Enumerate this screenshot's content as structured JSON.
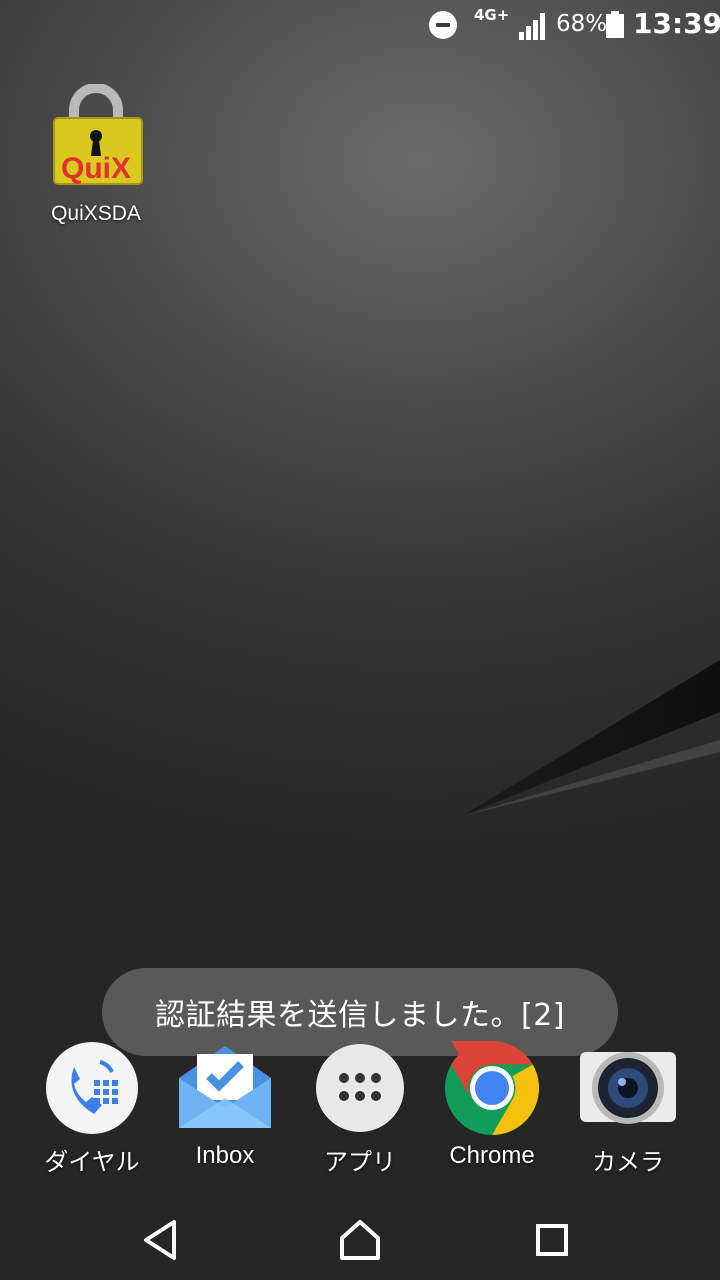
{
  "status_bar": {
    "network": "4G+",
    "battery_percent": "68%",
    "time": "13:39",
    "icons": [
      "do-not-disturb-icon",
      "signal-icon",
      "battery-icon"
    ]
  },
  "desktop": {
    "apps": [
      {
        "label": "QuiXSDA",
        "icon": "quixsda-lock-icon",
        "icon_text": "QuiX"
      }
    ]
  },
  "toast": {
    "message": "認証結果を送信しました。[2]"
  },
  "dock": {
    "items": [
      {
        "label": "ダイヤル",
        "icon": "phone-dialer-icon"
      },
      {
        "label": "Inbox",
        "icon": "inbox-icon"
      },
      {
        "label": "アプリ",
        "icon": "app-drawer-icon"
      },
      {
        "label": "Chrome",
        "icon": "chrome-icon"
      },
      {
        "label": "カメラ",
        "icon": "camera-icon"
      }
    ]
  },
  "nav_bar": {
    "buttons": [
      "back-icon",
      "home-icon",
      "recents-icon"
    ]
  },
  "colors": {
    "toast_bg": "#5c5c5c",
    "inbox_blue": "#4a90e2",
    "dialer_blue": "#3d7fe8",
    "chrome_red": "#db4437",
    "chrome_yellow": "#f4c20d",
    "chrome_green": "#0f9d58"
  }
}
